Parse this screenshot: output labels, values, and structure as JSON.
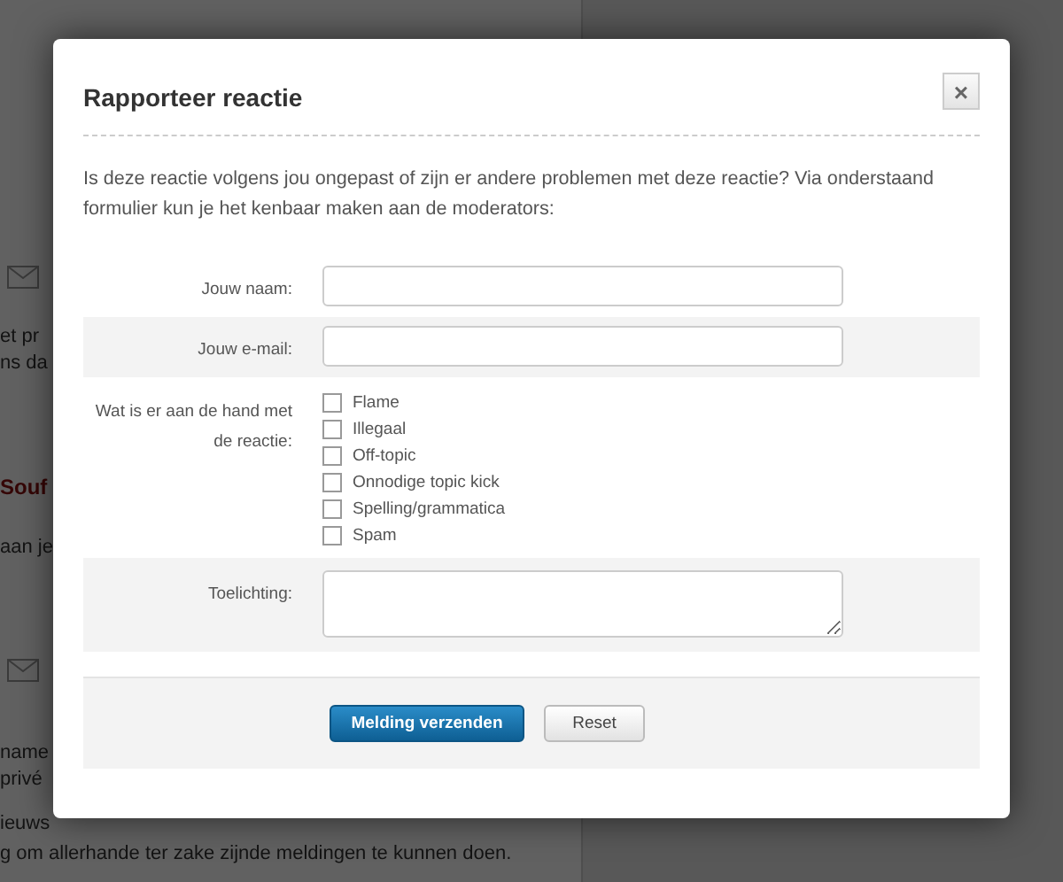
{
  "background_page": {
    "fragments_top": [
      "et pr",
      "ns da"
    ],
    "heading": "Souf",
    "fragment_mid": "aan je",
    "fragments_bottom": [
      "name",
      "privé",
      "ieuws"
    ],
    "lines": [
      "g om allerhande ter zake zijnde meldingen te kunnen doen."
    ]
  },
  "dialog": {
    "title": "Rapporteer reactie",
    "close": "×",
    "intro": "Is deze reactie volgens jou ongepast of zijn er andere problemen met deze reactie? Via onderstaand formulier kun je het kenbaar maken aan de moderators:",
    "name_label": "Jouw naam:",
    "email_label": "Jouw e-mail:",
    "problem_label": "Wat is er aan de hand met de reactie:",
    "options": [
      {
        "label": "Flame",
        "checked": false
      },
      {
        "label": "Illegaal",
        "checked": false
      },
      {
        "label": "Off-topic",
        "checked": false
      },
      {
        "label": "Onnodige topic kick",
        "checked": false
      },
      {
        "label": "Spelling/grammatica",
        "checked": false
      },
      {
        "label": "Spam",
        "checked": false
      }
    ],
    "comment_label": "Toelichting:",
    "submit": "Melding verzenden",
    "reset": "Reset"
  }
}
